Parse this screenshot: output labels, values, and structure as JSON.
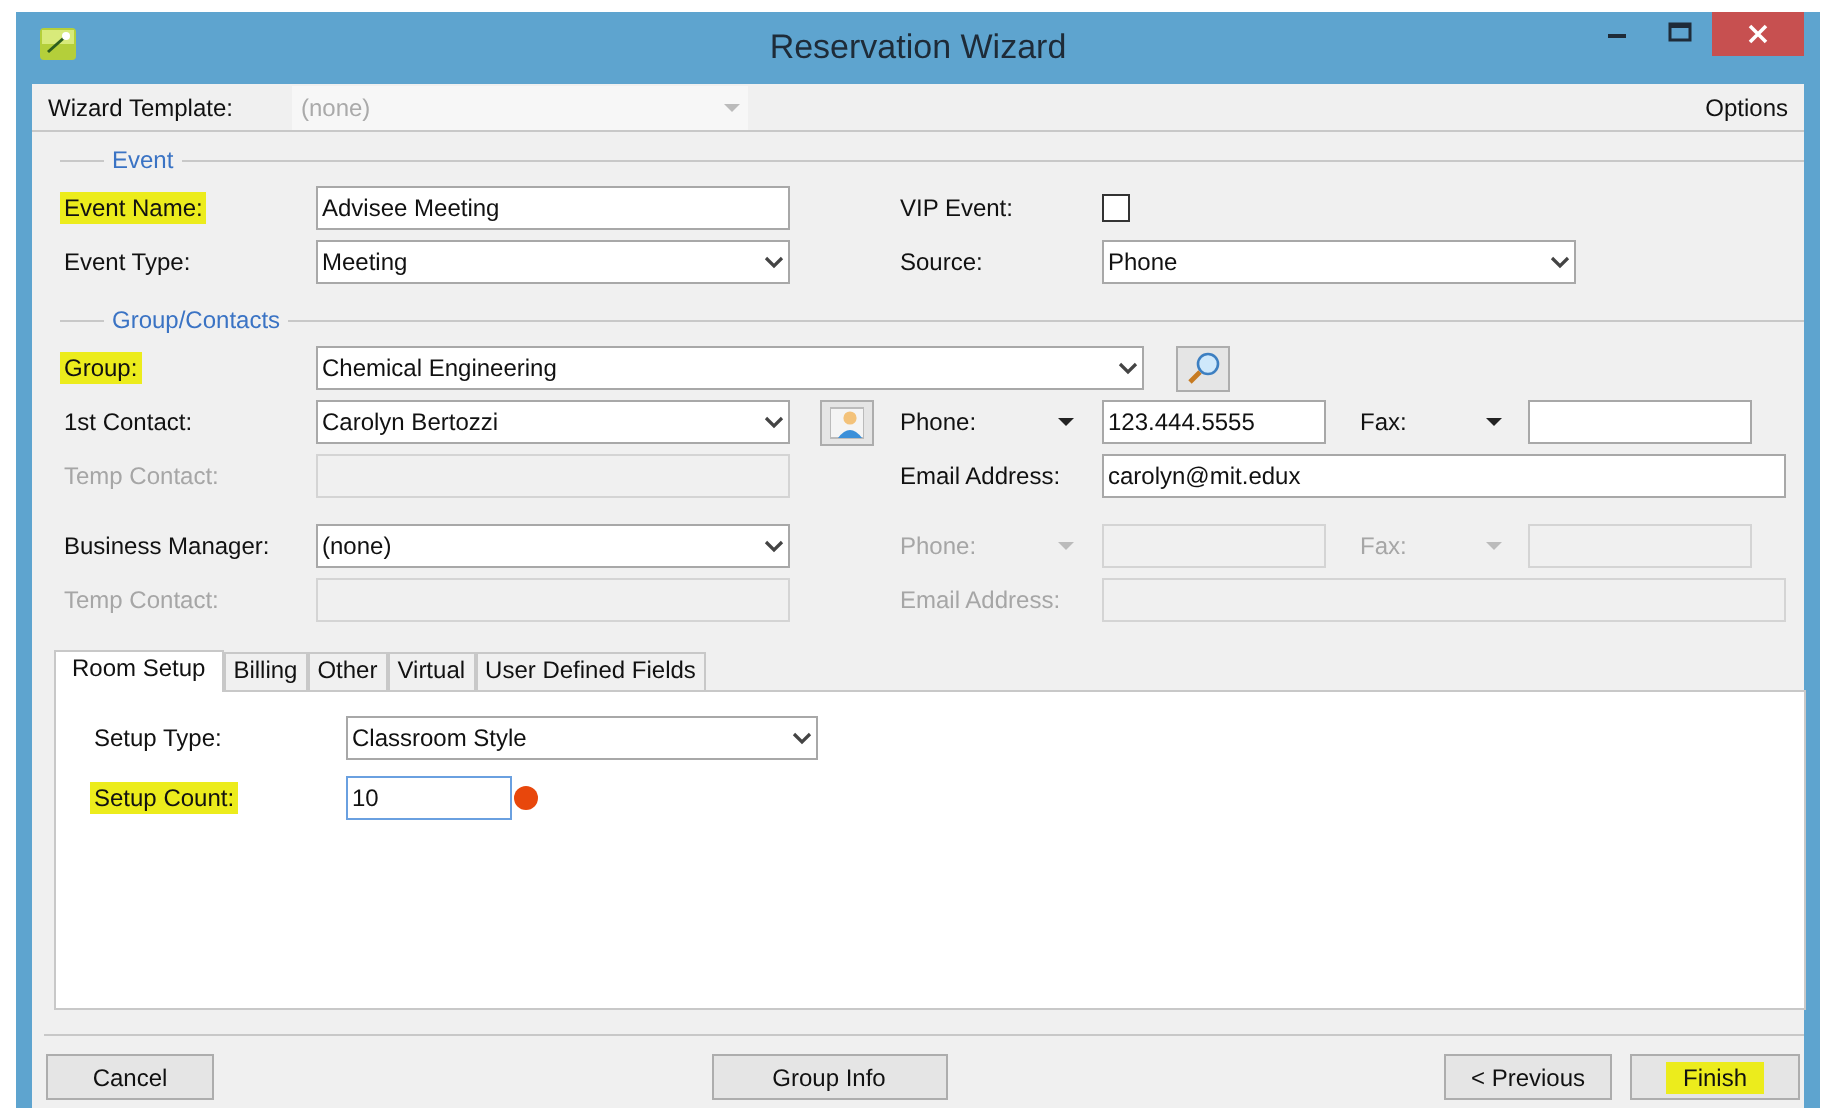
{
  "window": {
    "title": "Reservation Wizard"
  },
  "template": {
    "label": "Wizard Template:",
    "value": "(none)",
    "disabled": true
  },
  "options": "Options",
  "event": {
    "legend": "Event",
    "name": {
      "label": "Event Name:",
      "value": "Advisee Meeting",
      "highlighted": true
    },
    "type": {
      "label": "Event Type:",
      "value": "Meeting",
      "highlighted": false
    },
    "vip": {
      "label": "VIP Event:",
      "checked": false
    },
    "source": {
      "label": "Source:",
      "value": "Phone"
    }
  },
  "group_contacts": {
    "legend": "Group/Contacts",
    "group": {
      "label": "Group:",
      "value": "Chemical Engineering",
      "highlighted": true
    },
    "contacts": [
      {
        "label": "1st Contact:",
        "value": "Carolyn Bertozzi",
        "lookup_button": true,
        "temp_label": "Temp Contact:",
        "temp_disabled": true,
        "phone_label": "Phone:",
        "phone": "123.444.5555",
        "fax_label": "Fax:",
        "email_label": "Email Address:",
        "email": "carolyn@mit.edux",
        "details_disabled": false
      },
      {
        "label": "Business Manager:",
        "value": "(none)",
        "lookup_button": false,
        "temp_label": "Temp Contact:",
        "temp_disabled": true,
        "phone_label": "Phone:",
        "fax_label": "Fax:",
        "email_label": "Email Address:",
        "details_disabled": true
      }
    ]
  },
  "tabs": [
    {
      "label": "Room Setup",
      "selected": true
    },
    {
      "label": "Billing",
      "selected": false
    },
    {
      "label": "Other",
      "selected": false
    },
    {
      "label": "Virtual",
      "selected": false
    },
    {
      "label": "User Defined Fields",
      "selected": false
    }
  ],
  "room_setup": {
    "setup_type": {
      "label": "Setup Type:",
      "value": "Classroom Style",
      "highlighted": false
    },
    "setup_count": {
      "label": "Setup Count:",
      "value": "10",
      "highlighted": true,
      "focused": true,
      "required": true
    }
  },
  "button_groups": [
    [
      {
        "label": "Cancel",
        "highlighted": false
      }
    ],
    [
      {
        "label": "Group Info",
        "highlighted": false
      }
    ],
    [
      {
        "label": "< Previous",
        "highlighted": false
      },
      {
        "label": "Finish",
        "highlighted": true
      }
    ]
  ]
}
